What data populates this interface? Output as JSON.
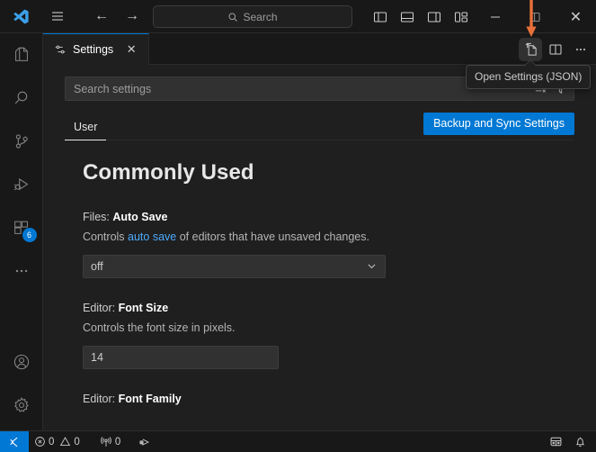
{
  "app": {
    "name": "Visual Studio Code",
    "accent_color": "#0078d4",
    "background_color": "#1f1f1f",
    "titlebar_color": "#181818",
    "annotation_arrow_color": "#e8703a"
  },
  "titlebar": {
    "logo_icon": "vscode-logo-icon",
    "menu_icon": "hamburger-menu-icon",
    "back_label": "←",
    "forward_label": "→",
    "search": {
      "placeholder": "Search",
      "icon": "search-icon"
    },
    "layout_icons": [
      "toggle-primary-sidebar-icon",
      "toggle-panel-icon",
      "toggle-secondary-sidebar-icon",
      "customize-layout-icon"
    ],
    "window_controls": {
      "minimize": "—",
      "maximize": "maximize-icon",
      "close": "✕"
    }
  },
  "activitybar": {
    "items": [
      {
        "name": "explorer",
        "icon": "files-icon",
        "badge": ""
      },
      {
        "name": "search",
        "icon": "search-icon",
        "badge": ""
      },
      {
        "name": "source-control",
        "icon": "source-control-icon",
        "badge": ""
      },
      {
        "name": "run-and-debug",
        "icon": "run-and-debug-icon",
        "badge": ""
      },
      {
        "name": "extensions",
        "icon": "extensions-icon",
        "badge": "6"
      },
      {
        "name": "additional-views",
        "icon": "ellipsis-icon",
        "badge": ""
      }
    ],
    "bottom_items": [
      {
        "name": "accounts",
        "icon": "account-icon"
      },
      {
        "name": "manage",
        "icon": "gear-icon"
      }
    ]
  },
  "tabs": {
    "items": [
      {
        "label": "Settings",
        "icon": "settings-gear-sliders-icon",
        "active": true,
        "close_label": "✕"
      }
    ],
    "actions": [
      {
        "name": "open-settings-json",
        "icon": "open-file-json-icon",
        "highlighted": true
      },
      {
        "name": "split-editor",
        "icon": "split-editor-icon",
        "highlighted": false
      },
      {
        "name": "more-actions",
        "icon": "ellipsis-icon",
        "highlighted": false
      }
    ]
  },
  "tooltip": {
    "text": "Open Settings (JSON)"
  },
  "settings": {
    "search": {
      "placeholder": "Search settings",
      "value": "",
      "clear_filters_icon": "clear-filters-icon",
      "filter_icon": "filter-funnel-icon"
    },
    "scope_tabs": [
      {
        "label": "User",
        "active": true
      }
    ],
    "sync_button": {
      "label": "Backup and Sync Settings"
    },
    "group_title": "Commonly Used",
    "items": [
      {
        "prefix": "Files: ",
        "name": "Auto Save",
        "desc_before": "Controls ",
        "desc_link": "auto save",
        "desc_after": " of editors that have unsaved changes.",
        "control": "select",
        "value": "off",
        "chevron_icon": "chevron-down-icon"
      },
      {
        "prefix": "Editor: ",
        "name": "Font Size",
        "desc_before": "Controls the font size in pixels.",
        "desc_link": "",
        "desc_after": "",
        "control": "input",
        "value": "14"
      },
      {
        "prefix": "Editor: ",
        "name": "Font Family",
        "desc_before": "",
        "desc_link": "",
        "desc_after": "",
        "control": "none",
        "value": ""
      }
    ]
  },
  "statusbar": {
    "remote": {
      "icon": "remote-window-icon",
      "label": ""
    },
    "left_items": [
      {
        "name": "problems",
        "errors_icon": "error-circle-icon",
        "errors": "0",
        "warnings_icon": "warning-triangle-icon",
        "warnings": "0"
      },
      {
        "name": "ports",
        "icon": "ports-radio-tower-icon",
        "count": "0"
      },
      {
        "name": "live-share",
        "icon": "live-share-icon",
        "count": ""
      }
    ],
    "right_items": [
      {
        "name": "feedback",
        "icon": "feedback-smiley-icon"
      },
      {
        "name": "notifications",
        "icon": "bell-icon"
      }
    ]
  }
}
